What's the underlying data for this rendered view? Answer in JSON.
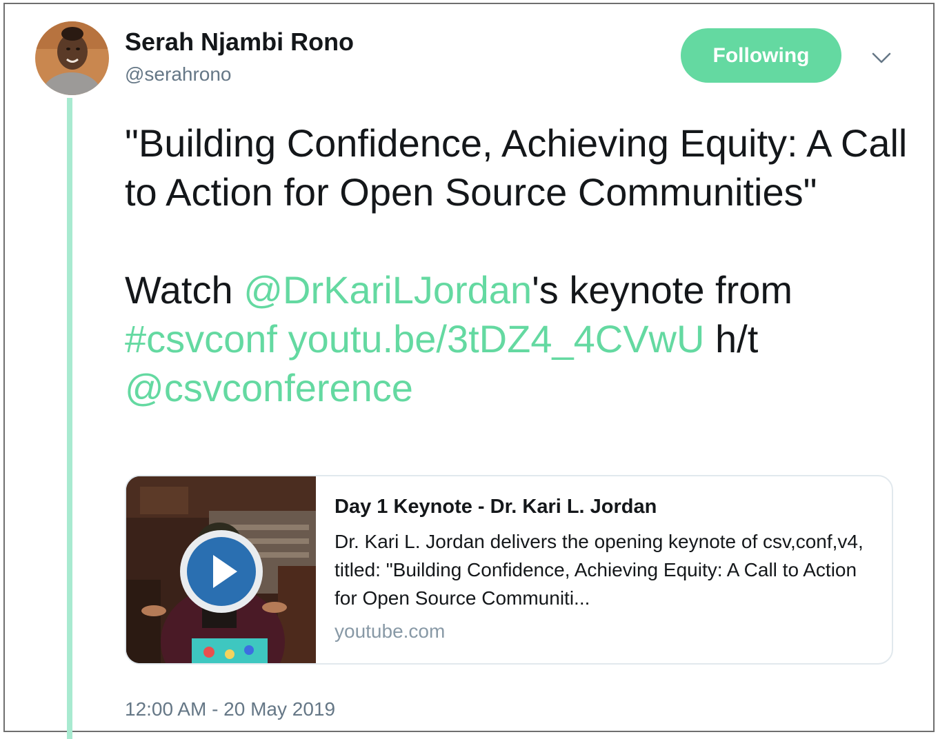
{
  "author": {
    "display_name": "Serah Njambi Rono",
    "handle": "@serahrono"
  },
  "follow_button": {
    "label": "Following"
  },
  "menu": {
    "icon": "chevron-down-icon"
  },
  "tweet": {
    "line1": "\"Building Confidence, Achieving Equity: A Call to Action for Open Source Communities\"",
    "watch_prefix": "Watch ",
    "mention1": "@DrKariLJordan",
    "keynote_text": "'s keynote from",
    "hashtag": "#csvconf",
    "link": "youtu.be/3tDZ4_4CVwU",
    "ht": "h/t",
    "mention2": "@csvconference"
  },
  "card": {
    "title": "Day 1 Keynote - Dr. Kari L. Jordan",
    "description": "Dr. Kari L. Jordan delivers the opening keynote of csv,conf,v4, titled: \"Building Confidence, Achieving Equity: A Call to Action for Open Source Communiti...",
    "domain": "youtube.com",
    "thumbnail_icon": "play-icon"
  },
  "timestamp": "12:00 AM - 20 May 2019",
  "colors": {
    "accent": "#64d9a1",
    "thread_line": "#a8ead0",
    "muted": "#657786"
  }
}
